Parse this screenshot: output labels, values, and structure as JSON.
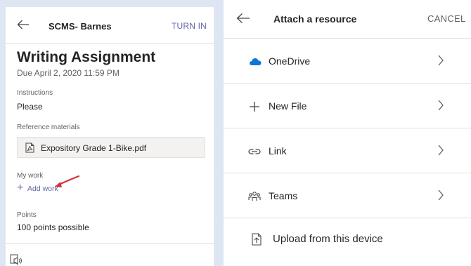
{
  "assignment_panel": {
    "header_title": "SCMS- Barnes",
    "turn_in_label": "TURN IN",
    "assignment_title": "Writing Assignment",
    "due_date": "Due April 2, 2020 11:59 PM",
    "instructions_label": "Instructions",
    "instructions_text": "Please",
    "reference_label": "Reference materials",
    "reference_file": "Expository Grade 1-Bike.pdf",
    "my_work_label": "My work",
    "add_work_label": "Add work",
    "points_label": "Points",
    "points_value": "100 points possible"
  },
  "attach_panel": {
    "title": "Attach a resource",
    "cancel_label": "CANCEL",
    "items": [
      {
        "label": "OneDrive",
        "icon": "onedrive-icon"
      },
      {
        "label": "New File",
        "icon": "plus-icon"
      },
      {
        "label": "Link",
        "icon": "link-icon"
      },
      {
        "label": "Teams",
        "icon": "teams-icon"
      },
      {
        "label": "Upload from this device",
        "icon": "upload-icon"
      }
    ]
  },
  "colors": {
    "accent": "#6264a7",
    "background": "#dfe6f3",
    "onedrive_blue": "#0f78d4",
    "annotation_red": "#d13438"
  }
}
